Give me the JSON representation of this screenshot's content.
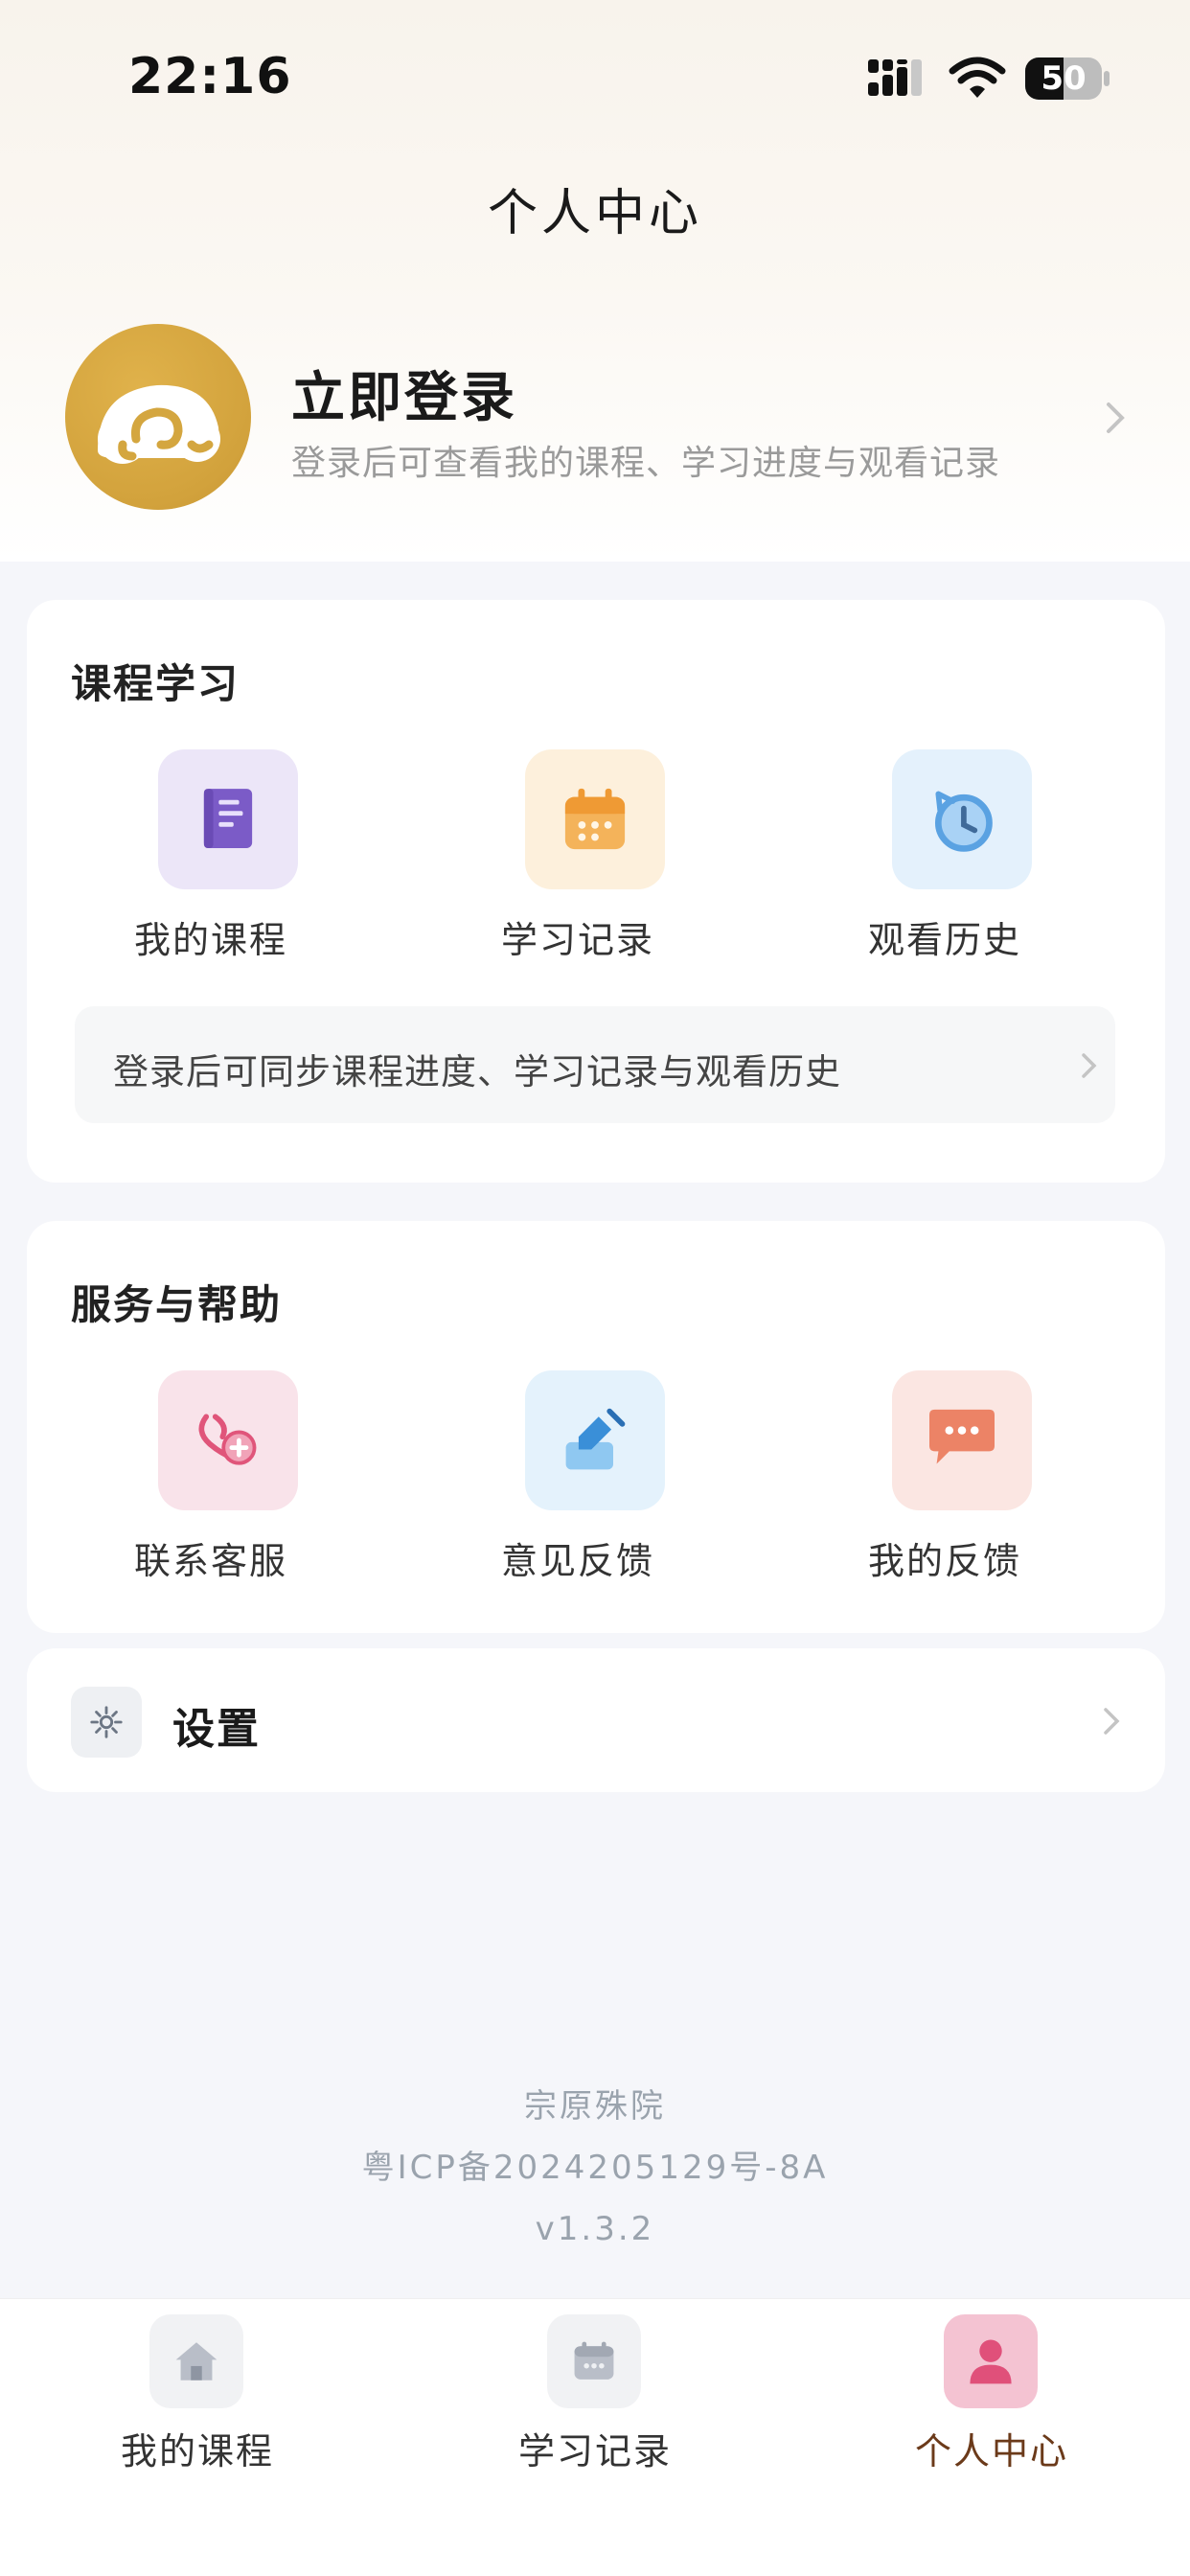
{
  "status_bar": {
    "time": "22:16",
    "battery": "50",
    "battery_level": 0.5
  },
  "header": {
    "title": "个人中心"
  },
  "profile": {
    "title": "立即登录",
    "subtitle": "登录后可查看我的课程、学习进度与观看记录"
  },
  "course_section": {
    "title": "课程学习",
    "items": [
      {
        "label": "我的课程",
        "icon": "book-icon",
        "tile_color": "#ece6f8",
        "icon_color": "#7b5bc7"
      },
      {
        "label": "学习记录",
        "icon": "calendar-icon",
        "tile_color": "#fdf0dc",
        "icon_color": "#efa43d"
      },
      {
        "label": "观看历史",
        "icon": "history-clock-icon",
        "tile_color": "#e4f1fc",
        "icon_color": "#5aa2e2"
      }
    ],
    "notice": "登录后可同步课程进度、学习记录与观看历史"
  },
  "service_section": {
    "title": "服务与帮助",
    "items": [
      {
        "label": "联系客服",
        "icon": "customer-service-icon",
        "tile_color": "#f9e3ea",
        "icon_color": "#e0557a"
      },
      {
        "label": "意见反馈",
        "icon": "edit-icon",
        "tile_color": "#e4f2fc",
        "icon_color": "#4aa3e4"
      },
      {
        "label": "我的反馈",
        "icon": "chat-bubble-icon",
        "tile_color": "#fbe6e2",
        "icon_color": "#ec8366"
      }
    ]
  },
  "settings": {
    "label": "设置",
    "icon": "gear-icon"
  },
  "footer": {
    "org": "宗原殊院",
    "icp": "粤ICP备2024205129号-8A",
    "version": "v1.3.2"
  },
  "tabbar": {
    "tabs": [
      {
        "label": "我的课程",
        "icon": "home-icon",
        "active": false
      },
      {
        "label": "学习记录",
        "icon": "calendar-icon",
        "active": false
      },
      {
        "label": "个人中心",
        "icon": "person-icon",
        "active": true
      }
    ],
    "active_color": "#6b3a1a",
    "active_icon_color": "#e0507a"
  }
}
